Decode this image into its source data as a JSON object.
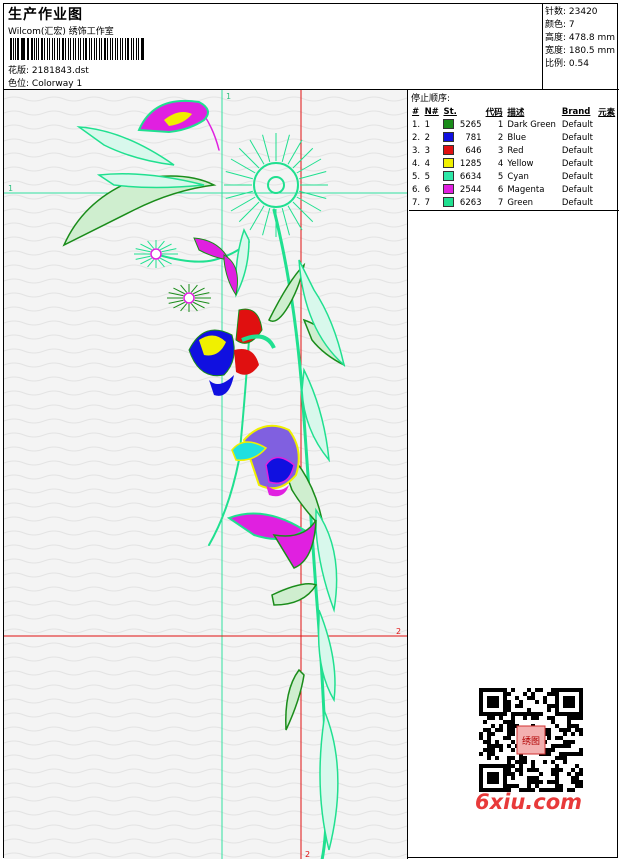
{
  "header": {
    "title": "生产作业图",
    "company": "Wilcom(汇宏) 绣饰工作室",
    "design_label": "花版:",
    "design_value": "2181843.dst",
    "colorway_label": "色位:",
    "colorway_value": "Colorway 1"
  },
  "stats": {
    "stitches": "针数: 23420",
    "colors": "颜色: 7",
    "height": "高度: 478.8 mm",
    "width": "宽度: 180.5 mm",
    "scale": "比例: 0.54"
  },
  "stop_sequence": {
    "title": "停止顺序:",
    "columns": [
      "#",
      "N#",
      "St.",
      "代码",
      "描述",
      "Brand",
      "元素"
    ],
    "rows": [
      {
        "idx": "1.",
        "n": "1",
        "color": "#1a8c1a",
        "st": "5265",
        "code": "1",
        "desc": "Dark Green",
        "brand": "Default"
      },
      {
        "idx": "2.",
        "n": "2",
        "color": "#1010e0",
        "st": "781",
        "code": "2",
        "desc": "Blue",
        "brand": "Default"
      },
      {
        "idx": "3.",
        "n": "3",
        "color": "#e01010",
        "st": "646",
        "code": "3",
        "desc": "Red",
        "brand": "Default"
      },
      {
        "idx": "4.",
        "n": "4",
        "color": "#f0f000",
        "st": "1285",
        "code": "4",
        "desc": "Yellow",
        "brand": "Default"
      },
      {
        "idx": "5.",
        "n": "5",
        "color": "#2ee8a8",
        "st": "6634",
        "code": "5",
        "desc": "Cyan",
        "brand": "Default"
      },
      {
        "idx": "6.",
        "n": "6",
        "color": "#e020e0",
        "st": "2544",
        "code": "6",
        "desc": "Magenta",
        "brand": "Default"
      },
      {
        "idx": "7.",
        "n": "7",
        "color": "#20e090",
        "st": "6263",
        "code": "7",
        "desc": "Green",
        "brand": "Default"
      }
    ]
  },
  "canvas": {
    "guide_labels": {
      "v1": "1",
      "h1": "1",
      "h2": "2",
      "v2": "2"
    }
  },
  "watermark": "6xiu.com",
  "qr_label": "绣图"
}
